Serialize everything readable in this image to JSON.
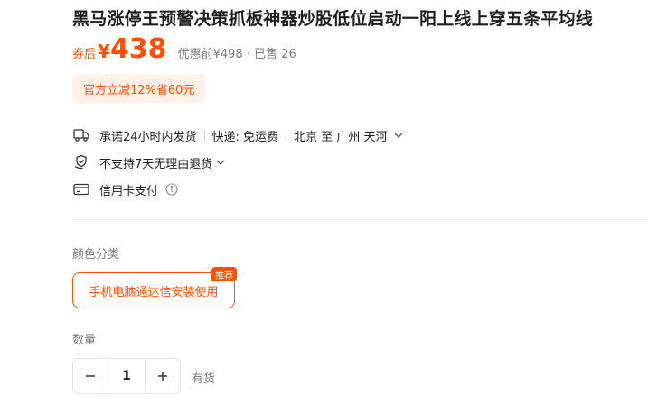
{
  "product": {
    "title": "黑马涨停王预警决策抓板神器炒股低位启动一阳上线上穿五条平均线"
  },
  "price": {
    "coupon_label": "券后",
    "currency": "¥",
    "value": "438",
    "original": "优惠前¥498 · 已售 26",
    "accent_color": "#ff5000"
  },
  "promo": {
    "text": "官方立减12%省60元"
  },
  "services": {
    "shipping": {
      "promise": "承诺24小时内发货",
      "express": "快递: 免运费",
      "route": "北京 至 广州 天河",
      "icon": "truck-icon"
    },
    "returns": {
      "text": "不支持7天无理由退货",
      "icon": "shield-hand-icon"
    },
    "payment": {
      "text": "信用卡支付",
      "icon": "credit-card-icon"
    }
  },
  "sku": {
    "label": "颜色分类",
    "options": [
      {
        "text": "手机电脑通达信安装使用",
        "badge": "推荐",
        "selected": true
      }
    ]
  },
  "quantity": {
    "label": "数量",
    "value": "1",
    "stock": "有货"
  }
}
